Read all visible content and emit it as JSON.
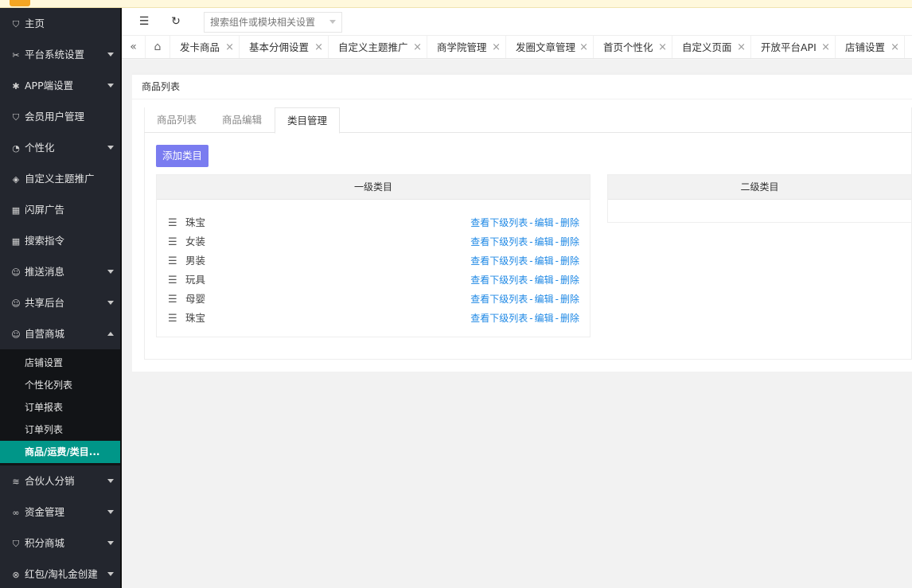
{
  "sidebar": {
    "items": [
      {
        "label": "主页",
        "icon": "shield-check-icon",
        "has_arrow": false
      },
      {
        "label": "平台系统设置",
        "icon": "tools-icon",
        "has_arrow": true
      },
      {
        "label": "APP端设置",
        "icon": "gear-icon",
        "has_arrow": true
      },
      {
        "label": "会员用户管理",
        "icon": "shield-check-icon",
        "has_arrow": false
      },
      {
        "label": "个性化",
        "icon": "palette-icon",
        "has_arrow": true
      },
      {
        "label": "自定义主题推广",
        "icon": "cube-icon",
        "has_arrow": false
      },
      {
        "label": "闪屏广告",
        "icon": "apps-icon",
        "has_arrow": false
      },
      {
        "label": "搜索指令",
        "icon": "apps-icon",
        "has_arrow": false
      },
      {
        "label": "推送消息",
        "icon": "user-icon",
        "has_arrow": true
      },
      {
        "label": "共享后台",
        "icon": "user-icon",
        "has_arrow": true
      },
      {
        "label": "自营商城",
        "icon": "user-icon",
        "has_arrow": true,
        "open": true
      }
    ],
    "sub_items": [
      {
        "label": "店铺设置"
      },
      {
        "label": "个性化列表"
      },
      {
        "label": "订单报表"
      },
      {
        "label": "订单列表"
      },
      {
        "label": "商品/运费/类目...",
        "active": true
      }
    ],
    "items_after": [
      {
        "label": "合伙人分销",
        "icon": "layers-icon",
        "has_arrow": true
      },
      {
        "label": "资金管理",
        "icon": "link-icon",
        "has_arrow": true
      },
      {
        "label": "积分商城",
        "icon": "shield-check-icon",
        "has_arrow": true
      },
      {
        "label": "红包/淘礼金创建",
        "icon": "circle-x-icon",
        "has_arrow": true
      }
    ]
  },
  "header": {
    "search_placeholder": "搜索组件或模块相关设置"
  },
  "tabs": [
    {
      "label": "发卡商品"
    },
    {
      "label": "基本分佣设置"
    },
    {
      "label": "自定义主题推广"
    },
    {
      "label": "商学院管理"
    },
    {
      "label": "发圈文章管理"
    },
    {
      "label": "首页个性化"
    },
    {
      "label": "自定义页面"
    },
    {
      "label": "开放平台API"
    },
    {
      "label": "店铺设置"
    }
  ],
  "page": {
    "title": "商品列表",
    "subtabs": [
      {
        "label": "商品列表"
      },
      {
        "label": "商品编辑"
      },
      {
        "label": "类目管理",
        "active": true
      }
    ],
    "add_button": "添加类目",
    "level1_title": "一级类目",
    "level2_title": "二级类目",
    "categories": [
      {
        "name": "珠宝"
      },
      {
        "name": "女装"
      },
      {
        "name": "男装"
      },
      {
        "name": "玩具"
      },
      {
        "name": "母婴"
      },
      {
        "name": "珠宝"
      }
    ],
    "ops": {
      "view": "查看下级列表",
      "edit": "编辑",
      "delete": "删除",
      "sep": "-"
    }
  },
  "colors": {
    "sidebar_bg": "#23262e",
    "active_sub": "#009688",
    "primary_button": "#7a7cf0",
    "link": "#1e88e5"
  }
}
